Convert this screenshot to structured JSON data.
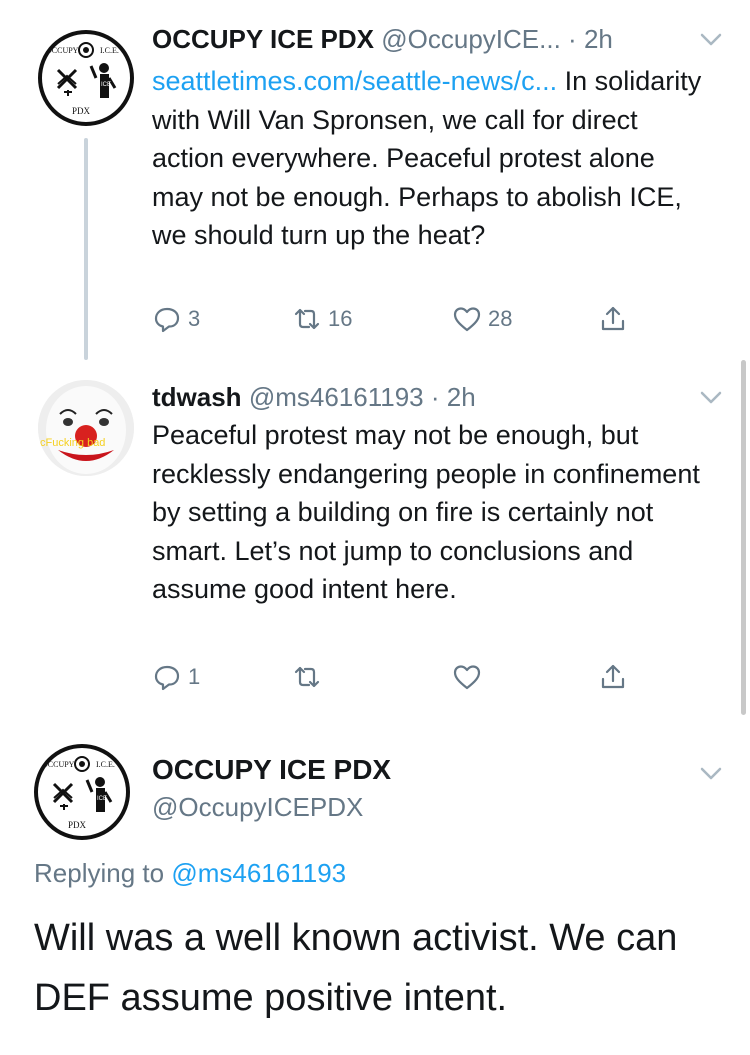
{
  "tweets": [
    {
      "name": "OCCUPY ICE PDX",
      "handle": "@OccupyICE...",
      "time": "2h",
      "link": "seattletimes.com/seattle-news/c...",
      "text": " In solidarity with Will Van Spronsen, we call for direct action everywhere. Peaceful protest alone may not be enough. Perhaps to abolish ICE, we should turn up the heat?",
      "replies": "3",
      "retweets": "16",
      "likes": "28",
      "avatar_texts": [
        "OCCUPY",
        "I.C.E.",
        "PDX",
        "ICE"
      ]
    },
    {
      "name": "tdwash",
      "handle": "@ms46161193",
      "time": "2h",
      "text": "Peaceful protest may not be enough, but recklessly endangering people in confinement by setting a building on fire is certainly not smart. Let’s not jump to conclusions and assume good intent here.",
      "replies": "1",
      "retweets": "",
      "likes": "",
      "avatar_caption": "cFucking bad"
    }
  ],
  "main_tweet": {
    "name": "OCCUPY ICE PDX",
    "handle": "@OccupyICEPDX",
    "replying_prefix": "Replying to ",
    "replying_handle": "@ms46161193",
    "text": "Will was a well known activist. We can DEF assume positive intent."
  },
  "icons": [
    "reply-icon",
    "retweet-icon",
    "like-icon",
    "share-icon",
    "chevron-down-icon"
  ],
  "colors": {
    "accent": "#1da1f2",
    "muted": "#657786",
    "text": "#14171a",
    "thread_line": "#c9d3db"
  }
}
